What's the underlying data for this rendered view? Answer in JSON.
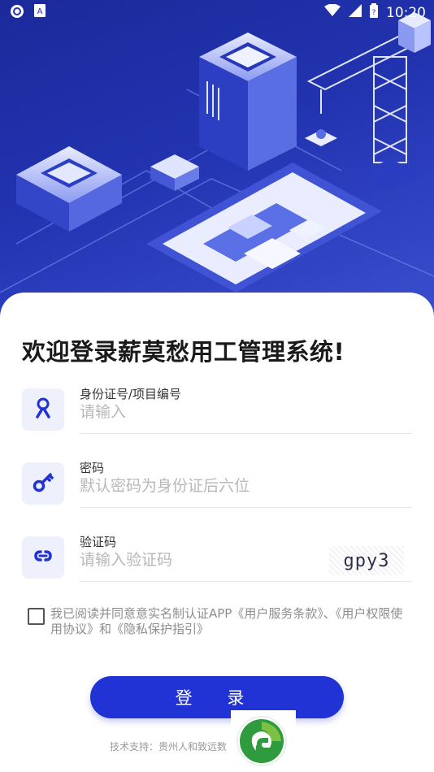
{
  "status_bar": {
    "time": "10:20",
    "left_icons": [
      "sync-icon",
      "text-badge-icon"
    ],
    "right_icons": [
      "wifi-icon",
      "signal-icon",
      "battery-icon"
    ]
  },
  "login": {
    "title": "欢迎登录薪莫愁用工管理系统!",
    "fields": [
      {
        "label": "身份证号/项目编号",
        "placeholder": "请输入",
        "value": "",
        "icon": "person-icon"
      },
      {
        "label": "密码",
        "placeholder": "默认密码为身份证后六位",
        "value": "",
        "icon": "key-icon"
      },
      {
        "label": "验证码",
        "placeholder": "请输入验证码",
        "value": "",
        "icon": "link-icon"
      }
    ],
    "captcha_text": "gpy3",
    "agreement_text": "我已阅读并同意意实名制认证APP《用户服务条款》、《用户权限使用协议》和《隐私保护指引》",
    "agreement_checked": false,
    "login_button": "登 录",
    "support_text": "技术支持：贵州人和致远数"
  },
  "colors": {
    "accent": "#2233d6",
    "hero_bg": "#1b2a9a",
    "icon_box_bg": "#eef0fb"
  }
}
